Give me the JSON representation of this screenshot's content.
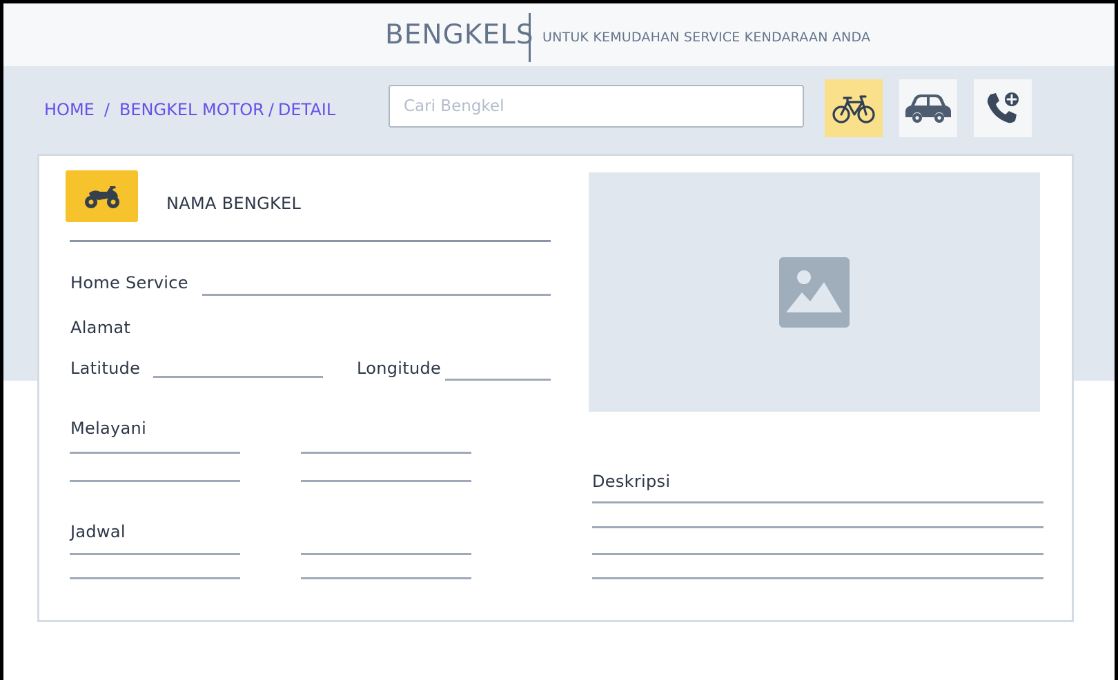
{
  "header": {
    "brand": "BENGKELS",
    "tagline": "UNTUK KEMUDAHAN SERVICE KENDARAAN ANDA"
  },
  "breadcrumb": {
    "home": "HOME",
    "separator": "/",
    "category": "BENGKEL MOTOR",
    "separator2": "/",
    "current": "DETAIL"
  },
  "search": {
    "placeholder": "Cari Bengkel",
    "value": ""
  },
  "category_buttons": [
    {
      "icon": "bicycle-icon",
      "active": true
    },
    {
      "icon": "car-icon",
      "active": false
    },
    {
      "icon": "phone-plus-icon",
      "active": false
    }
  ],
  "detail": {
    "shop_icon": "motorcycle-icon",
    "shop_name": "NAMA BENGKEL",
    "home_service_label": "Home Service",
    "address_label": "Alamat",
    "latitude_label": "Latitude",
    "longitude_label": "Longitude",
    "serves_label": "Melayani",
    "schedule_label": "Jadwal",
    "description_label": "Deskripsi",
    "photo_icon": "image-placeholder-icon"
  },
  "colors": {
    "accent_link": "#6452e8",
    "active_category": "#fbe08c",
    "shop_icon_bg": "#f6c32c",
    "band": "#e1e7ef",
    "text": "#2d3748"
  }
}
